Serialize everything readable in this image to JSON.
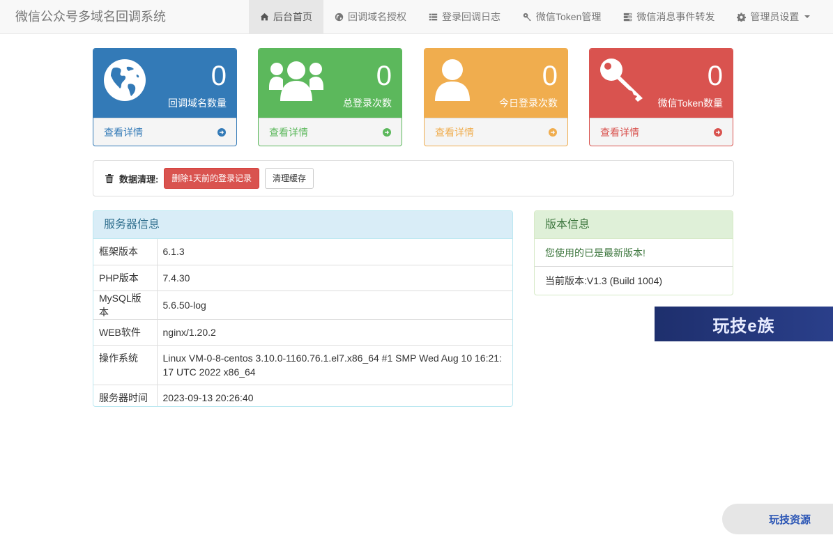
{
  "brand": "微信公众号多域名回调系统",
  "nav": [
    {
      "label": "后台首页",
      "icon": "home-icon",
      "active": true
    },
    {
      "label": "回调域名授权",
      "icon": "globe-icon"
    },
    {
      "label": "登录回调日志",
      "icon": "list-icon"
    },
    {
      "label": "微信Token管理",
      "icon": "key-icon"
    },
    {
      "label": "微信消息事件转发",
      "icon": "tasks-icon"
    },
    {
      "label": "管理员设置",
      "icon": "gear-icon",
      "dropdown": true
    }
  ],
  "stats": [
    {
      "value": "0",
      "label": "回调域名数量",
      "link": "查看详情",
      "icon": "globe-icon",
      "color": "#337ab7"
    },
    {
      "value": "0",
      "label": "总登录次数",
      "link": "查看详情",
      "icon": "users-icon",
      "color": "#5cb85c"
    },
    {
      "value": "0",
      "label": "今日登录次数",
      "link": "查看详情",
      "icon": "user-icon",
      "color": "#f0ad4e"
    },
    {
      "value": "0",
      "label": "微信Token数量",
      "link": "查看详情",
      "icon": "key-icon",
      "color": "#d9534f"
    }
  ],
  "cleanup": {
    "title": "数据清理:",
    "delete_label": "删除1天前的登录记录",
    "cache_label": "清理缓存"
  },
  "server": {
    "title": "服务器信息",
    "rows": [
      {
        "key": "框架版本",
        "value": "6.1.3"
      },
      {
        "key": "PHP版本",
        "value": "7.4.30"
      },
      {
        "key": "MySQL版本",
        "value": "5.6.50-log"
      },
      {
        "key": "WEB软件",
        "value": "nginx/1.20.2"
      },
      {
        "key": "操作系统",
        "value": "Linux VM-0-8-centos 3.10.0-1160.76.1.el7.x86_64 #1 SMP Wed Aug 10 16:21:17 UTC 2022 x86_64"
      },
      {
        "key": "服务器时间",
        "value": "2023-09-13 20:26:40"
      }
    ]
  },
  "version": {
    "title": "版本信息",
    "status": "您使用的已是最新版本!",
    "current": "当前版本:V1.3 (Build 1004)"
  },
  "watermark": {
    "banner": "玩技e族",
    "corner": "玩技资源"
  }
}
